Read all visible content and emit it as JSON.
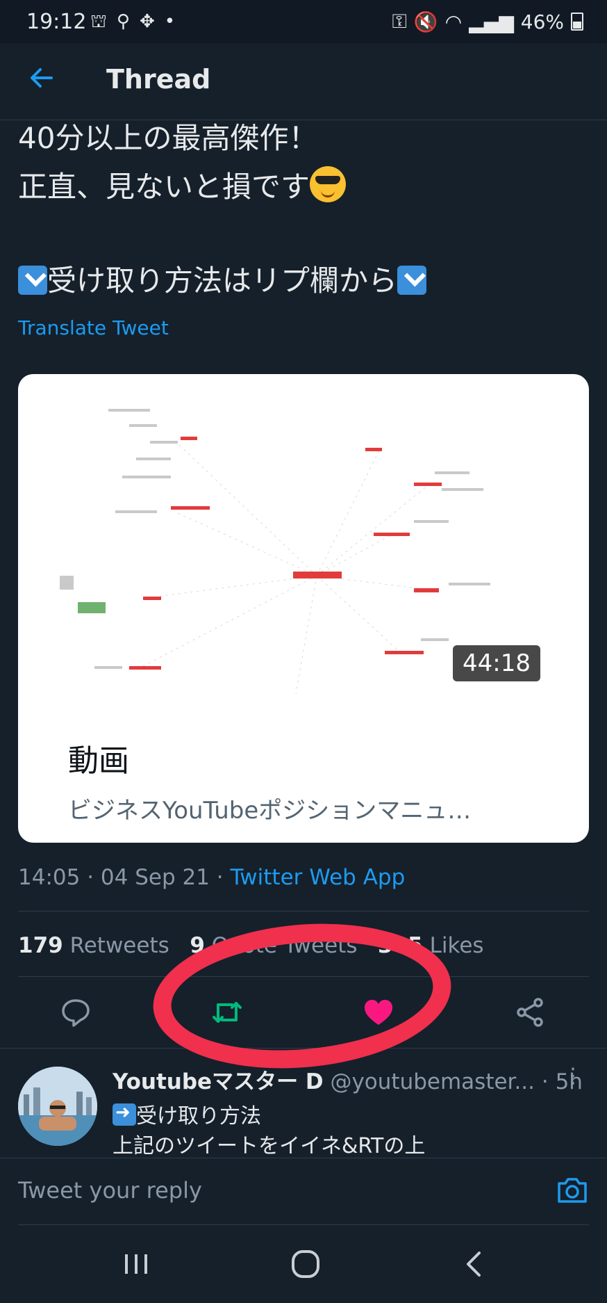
{
  "status_bar": {
    "time": "19:12",
    "battery": "46%"
  },
  "header": {
    "title": "Thread"
  },
  "tweet": {
    "lines": [
      "40分以上の最高傑作！",
      "正直、見ないと損です",
      "受け取り方法はリプ欄から"
    ],
    "translate_label": "Translate Tweet",
    "card": {
      "duration": "44:18",
      "title": "動画",
      "subtitle": "ビジネスYouTubeポジションマニュ…"
    },
    "timestamp": "14:05 · 04 Sep 21 · ",
    "source": "Twitter Web App",
    "stats": {
      "retweets_count": "179",
      "retweets_label": " Retweets",
      "quotes_count": "9",
      "quotes_label": " Quote Tweets",
      "likes_count": "305",
      "likes_label": " Likes"
    }
  },
  "reply_tweet": {
    "author_name": "Youtubeマスター D",
    "author_handle": " @youtubemaster...",
    "time": " · 5h",
    "line1": "受け取り方法",
    "line2": "上記のツイートをイイネ&RTの上"
  },
  "compose": {
    "placeholder": "Tweet your reply"
  },
  "colors": {
    "background": "#15202b",
    "accent": "#1d9bf0",
    "retweet_active": "#00ba7c",
    "like_active": "#f91880",
    "annotation_circle": "#f0304d"
  }
}
